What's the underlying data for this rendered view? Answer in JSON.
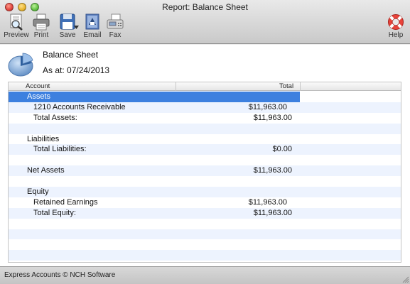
{
  "window": {
    "title": "Report: Balance Sheet"
  },
  "toolbar": {
    "preview": "Preview",
    "print": "Print",
    "save": "Save",
    "email": "Email",
    "fax": "Fax",
    "help": "Help"
  },
  "report": {
    "title": "Balance Sheet",
    "as_at": "As at: 07/24/2013",
    "columns": {
      "account": "Account",
      "total": "Total"
    },
    "rows": [
      {
        "label": "Assets",
        "amount": "",
        "indent": 1,
        "selected": true
      },
      {
        "label": "1210 Accounts Receivable",
        "amount": "$11,963.00",
        "indent": 2,
        "amount_col": "a"
      },
      {
        "label": "Total Assets:",
        "amount": "$11,963.00",
        "indent": 2,
        "amount_col": "b"
      },
      {
        "label": "",
        "amount": ""
      },
      {
        "label": "Liabilities",
        "amount": "",
        "indent": 1
      },
      {
        "label": "Total Liabilities:",
        "amount": "$0.00",
        "indent": 2,
        "amount_col": "b"
      },
      {
        "label": "",
        "amount": ""
      },
      {
        "label": "Net Assets",
        "amount": "$11,963.00",
        "indent": 1,
        "amount_col": "b"
      },
      {
        "label": "",
        "amount": ""
      },
      {
        "label": "Equity",
        "amount": "",
        "indent": 1
      },
      {
        "label": "Retained Earnings",
        "amount": "$11,963.00",
        "indent": 2,
        "amount_col": "a"
      },
      {
        "label": "Total Equity:",
        "amount": "$11,963.00",
        "indent": 2,
        "amount_col": "b"
      },
      {
        "label": "",
        "amount": ""
      },
      {
        "label": "",
        "amount": ""
      },
      {
        "label": "",
        "amount": ""
      },
      {
        "label": "",
        "amount": ""
      }
    ]
  },
  "status": {
    "text": "Express Accounts © NCH Software"
  },
  "colors": {
    "selection": "#3d80df",
    "stripe": "#edf3fe"
  }
}
